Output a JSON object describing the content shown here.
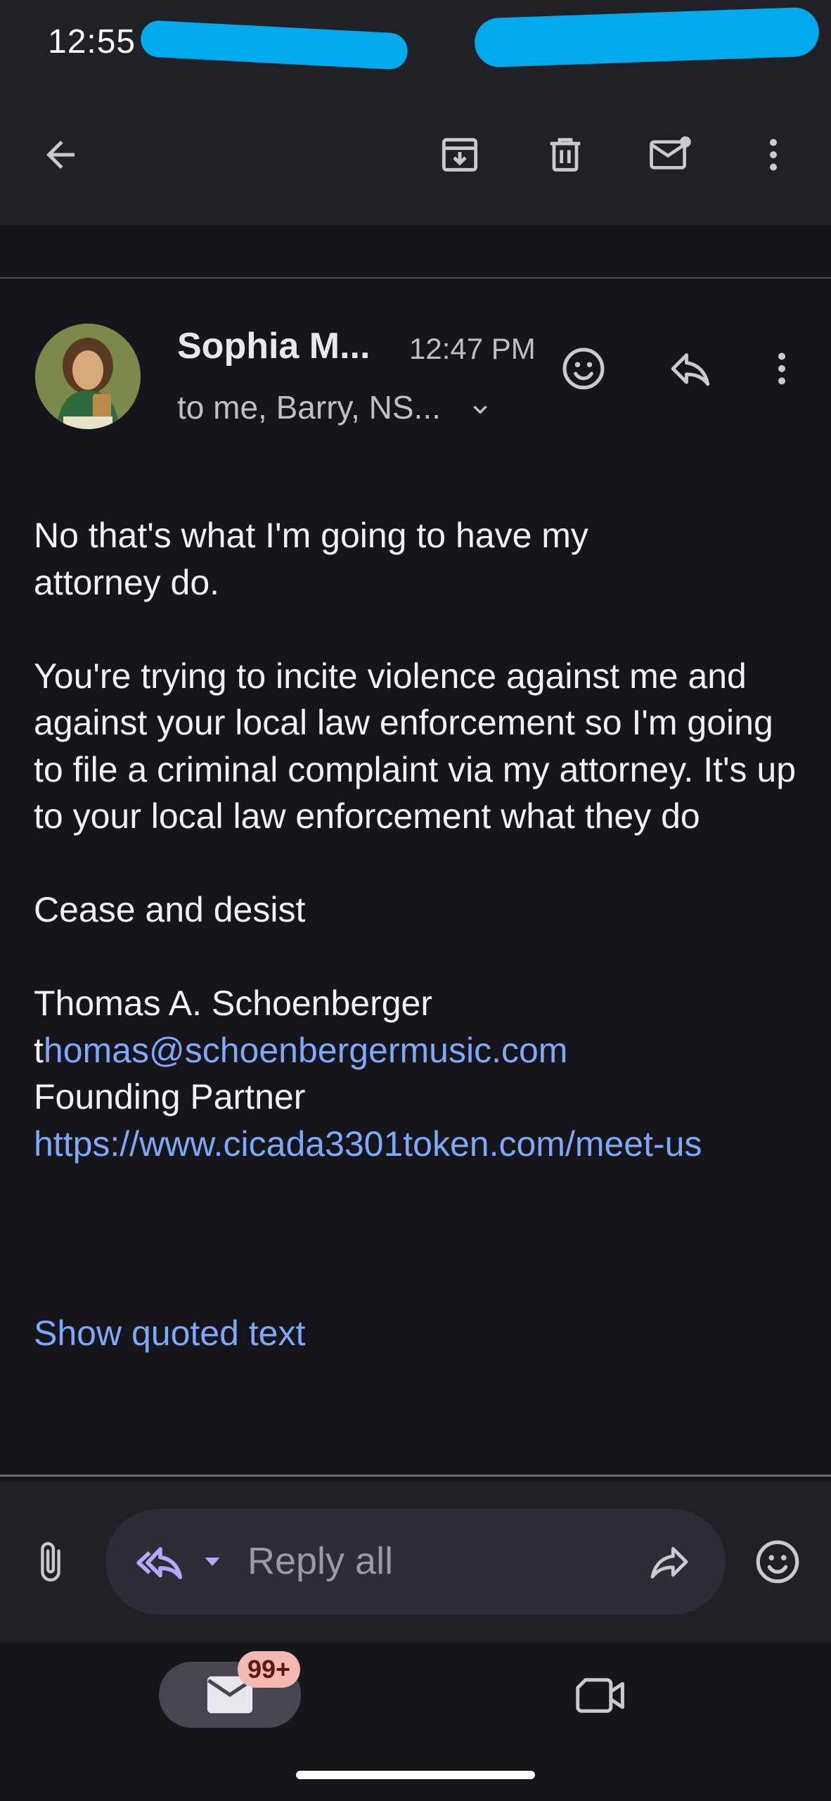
{
  "status_bar": {
    "time": "12:55"
  },
  "email": {
    "sender": "Sophia M...",
    "time": "12:47 PM",
    "recipients": "to me, Barry, NS...",
    "body": {
      "p1": "No that's what I'm going to have my attorney do.",
      "p2": "You're trying to incite violence against me and against your local law enforcement so I'm going to file a criminal complaint via my attorney. It's up to your local law enforcement what they do",
      "p3": "Cease and desist",
      "sig_name": "Thomas A. Schoenberger",
      "sig_email_first": "t",
      "sig_email_rest": "homas@schoenbergermusic.com",
      "sig_title": "Founding Partner",
      "sig_url": "https://www.cicada3301token.com/meet-us"
    },
    "show_quoted": "Show quoted text"
  },
  "reply": {
    "label": "Reply all"
  },
  "nav": {
    "mail_badge": "99+"
  },
  "colors": {
    "accent": "#7fa8f8",
    "redaction": "#02a9ec",
    "background": "#15151b"
  }
}
